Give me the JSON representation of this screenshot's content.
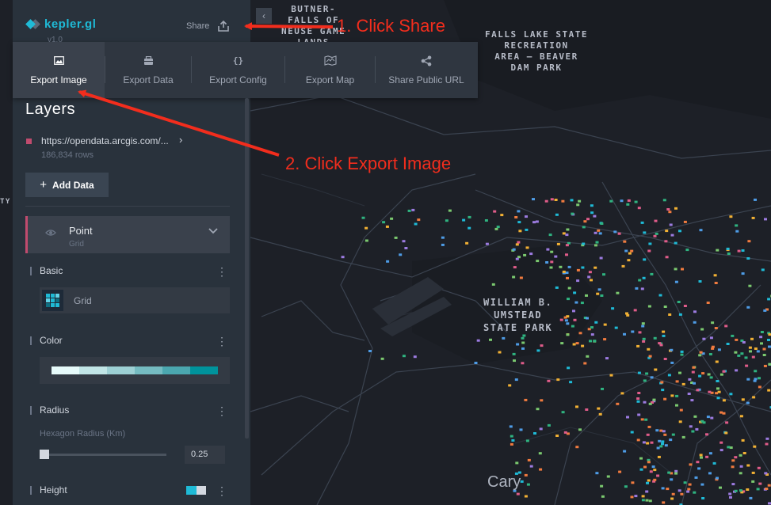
{
  "map": {
    "labels": {
      "butner": [
        "BUTNER-",
        "FALLS OF",
        "NEUSE GAME",
        "LANDS"
      ],
      "falls_lake": [
        "FALLS LAKE STATE",
        "RECREATION",
        "AREA – BEAVER",
        "DAM PARK"
      ],
      "umstead": [
        "WILLIAM B.",
        "UMSTEAD",
        "STATE PARK"
      ],
      "city": "Cary",
      "edge_fragment": "TY"
    }
  },
  "header": {
    "brand": "kepler.gl",
    "version": "v1.0",
    "share_label": "Share",
    "collapse_icon": "‹"
  },
  "toolbar": {
    "items": [
      {
        "label": "Export Image",
        "icon": "image-icon"
      },
      {
        "label": "Export Data",
        "icon": "database-icon"
      },
      {
        "label": "Export Config",
        "icon": "code-braces-icon"
      },
      {
        "label": "Export Map",
        "icon": "map-icon"
      },
      {
        "label": "Share Public URL",
        "icon": "share-icon"
      }
    ],
    "active": "Export Image"
  },
  "layers_panel": {
    "title": "Layers",
    "dataset": {
      "url": "https://opendata.arcgis.com/...",
      "rows": "186,834 rows",
      "color": "#c04b6e"
    },
    "add_data_label": "Add Data",
    "layer": {
      "name": "Point",
      "type": "Grid"
    },
    "basic": {
      "label": "Basic",
      "layer_type": "Grid"
    },
    "color": {
      "label": "Color",
      "palette": [
        "#e6fafa",
        "#c1e5e6",
        "#9dd0d4",
        "#75bbc1",
        "#4ba7af",
        "#00939c"
      ]
    },
    "radius": {
      "label": "Radius",
      "sub_label": "Hexagon Radius (Km)",
      "value": "0.25",
      "slider_fraction": 0.0
    },
    "height": {
      "label": "Height",
      "swatch": [
        "#1fbad6",
        "#d3d8e0"
      ]
    }
  },
  "annotations": {
    "step1": "1. Click Share",
    "step2": "2. Click Export Image"
  },
  "colors": {
    "accent": "#1fbad6",
    "annotation": "#f22d1d",
    "panel": "#29323c"
  }
}
